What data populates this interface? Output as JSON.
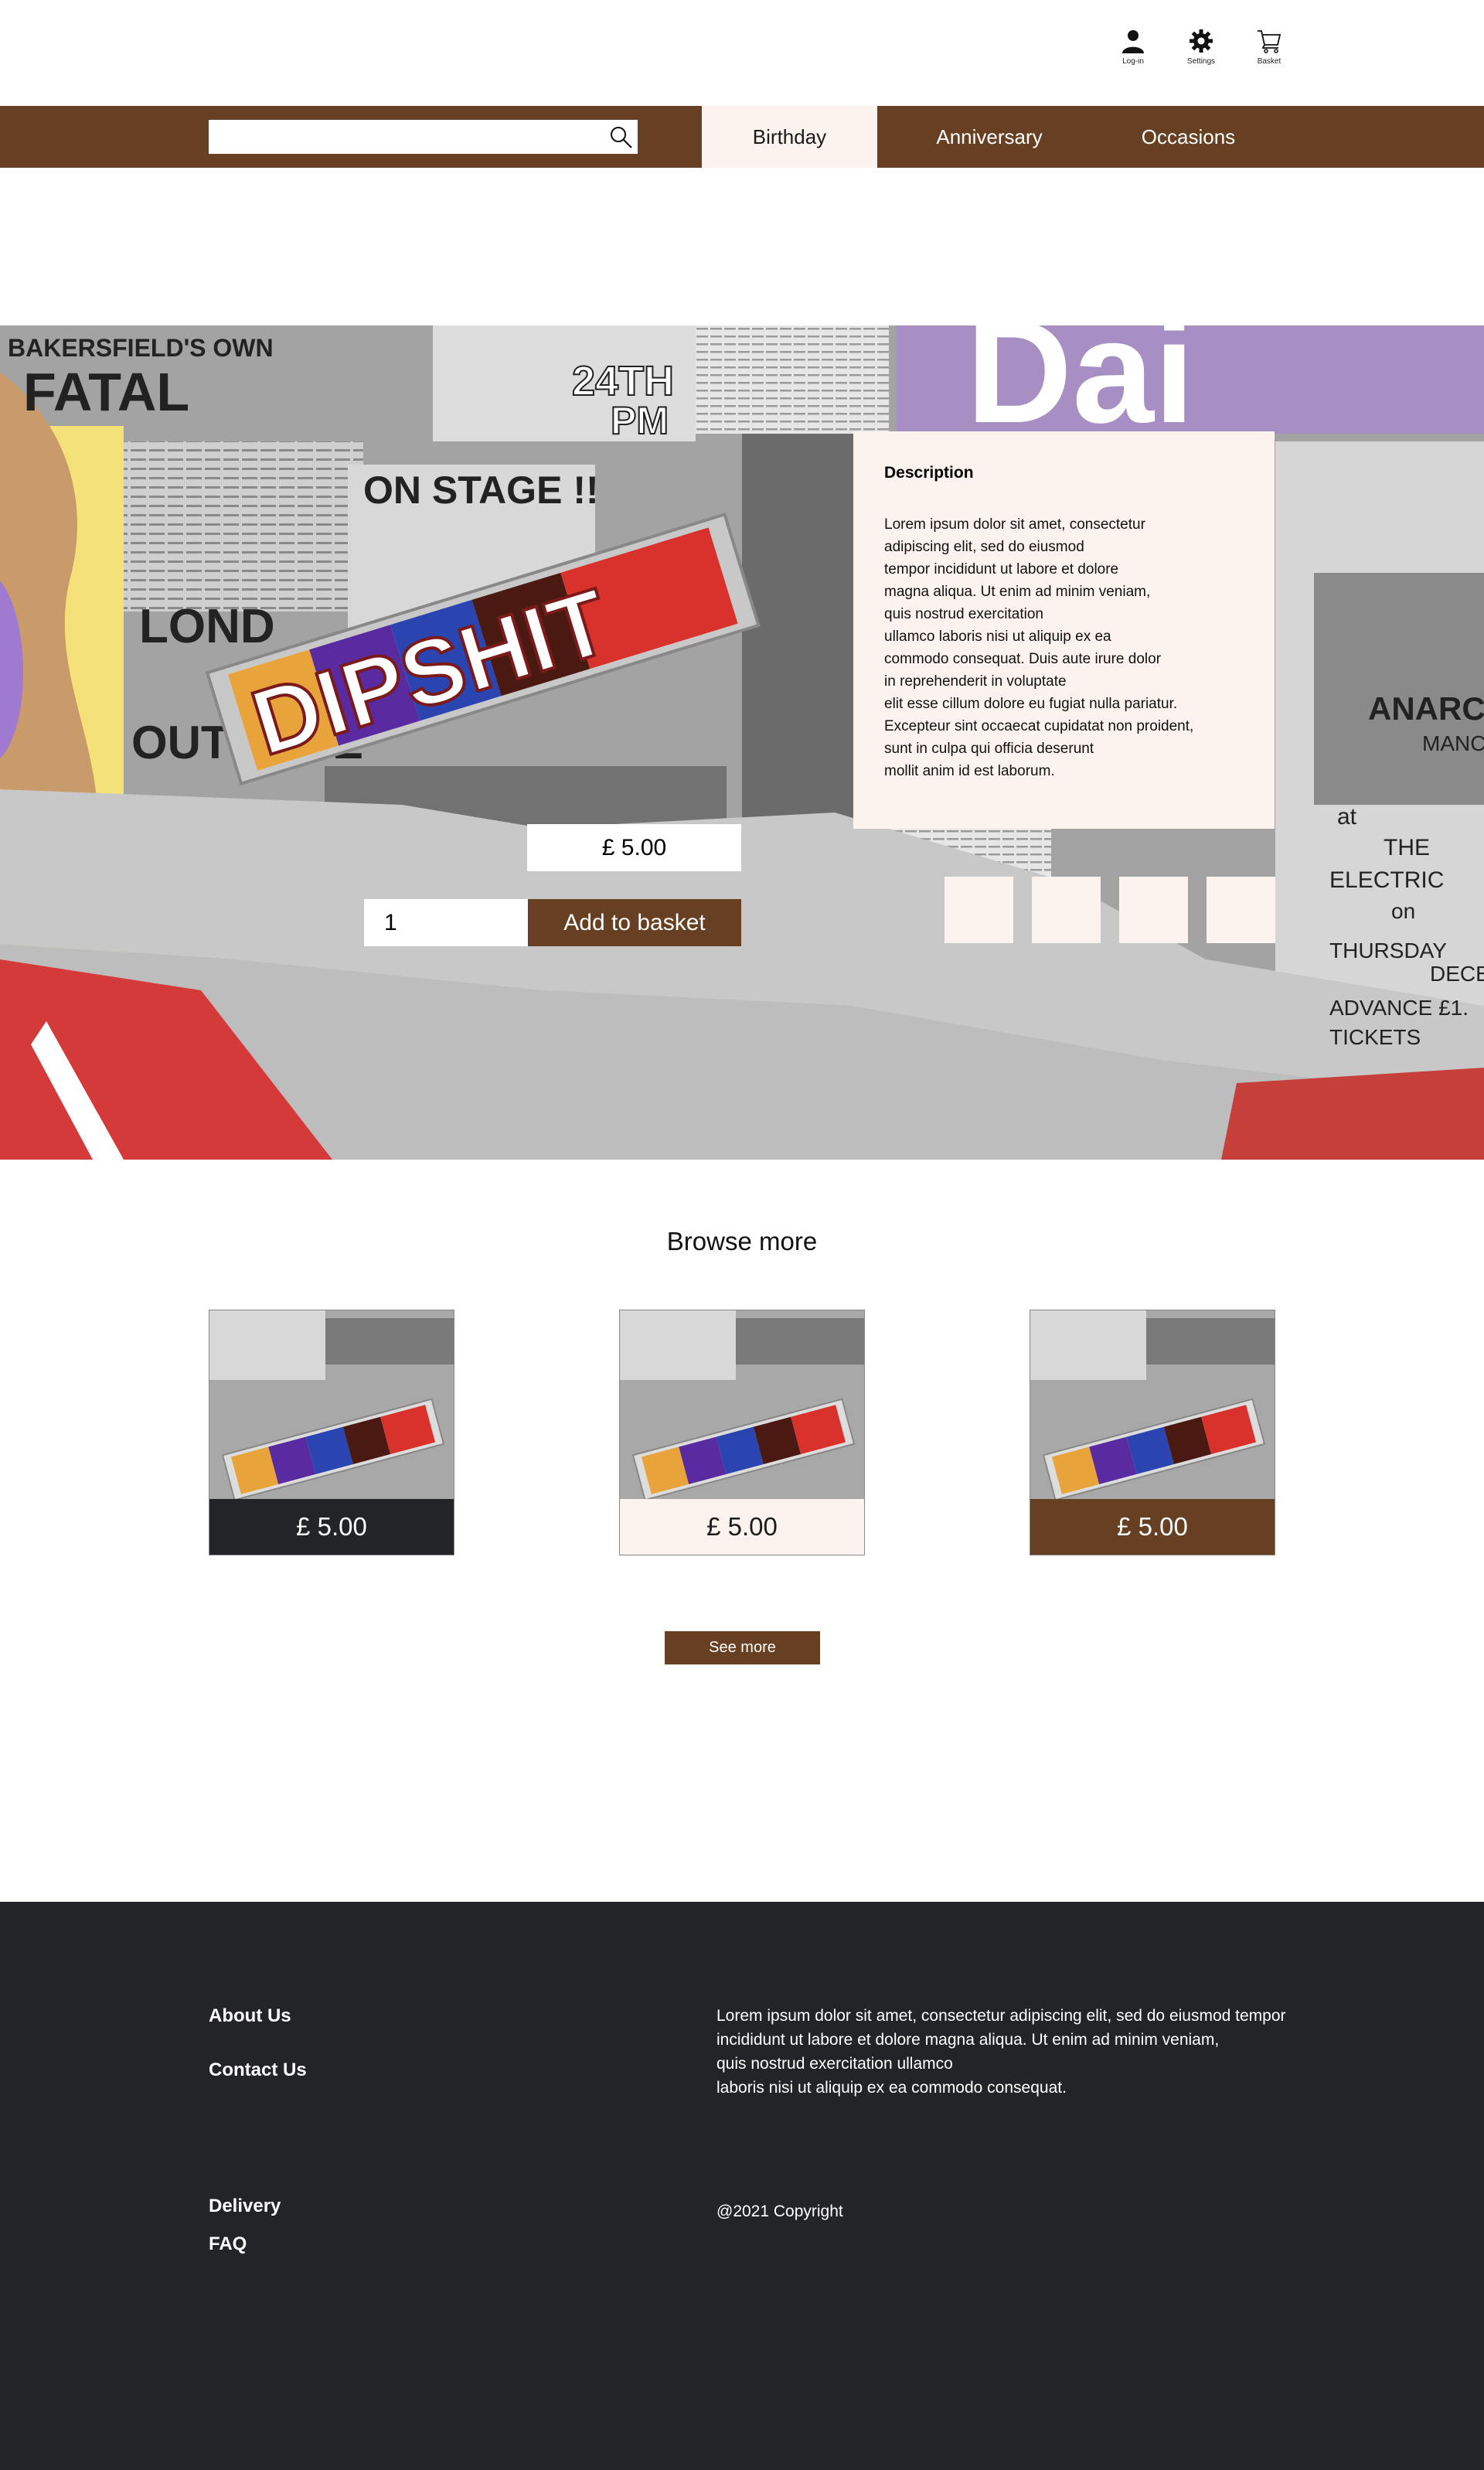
{
  "header": {
    "icons": [
      {
        "name": "user-icon",
        "label": "Log-in"
      },
      {
        "name": "gear-icon",
        "label": "Settings"
      },
      {
        "name": "cart-icon",
        "label": "Basket"
      }
    ]
  },
  "nav": {
    "search": {
      "value": "",
      "placeholder": ""
    },
    "tabs": [
      {
        "label": "Birthday",
        "active": true
      },
      {
        "label": "Anniversary",
        "active": false
      },
      {
        "label": "Occasions",
        "active": false
      }
    ]
  },
  "product": {
    "brand_text": "DIPSHIT",
    "description_title": "Description",
    "description_text": "Lorem ipsum dolor sit amet, consectetur\nadipiscing elit, sed do eiusmod\ntempor incididunt ut labore et dolore\nmagna aliqua. Ut enim ad minim veniam,\nquis nostrud exercitation\nullamco laboris nisi ut aliquip ex ea\ncommodo consequat. Duis aute irure dolor\nin reprehenderit in voluptate\nelit esse cillum dolore eu fugiat nulla pariatur.\nExcepteur sint occaecat cupidatat non proident,\nsunt in culpa qui officia deserunt\nmollit anim id est laborum.",
    "price": "£ 5.00",
    "quantity": "1",
    "add_to_basket": "Add to basket"
  },
  "collage_text": {
    "t1": "BAKERSFIELD'S OWN",
    "t2": "FATAL",
    "t3": "24TH",
    "t4": "PM",
    "t5": "ON STAGE !!",
    "t6": "LOND",
    "t7": "OUTRAGE",
    "t8": "ANARC",
    "t9": "MANC",
    "t10": "at",
    "t11": "THE",
    "t12": "ELECTRIC",
    "t13": "on",
    "t14": "THURSDAY",
    "t15": "DECE",
    "t16": "ADVANCE £1.",
    "t17": "TICKETS"
  },
  "browse": {
    "title": "Browse more",
    "cards": [
      {
        "price": "£ 5.00",
        "bg": "#232428",
        "color": "#ffffff"
      },
      {
        "price": "£ 5.00",
        "bg": "#fdf3ee",
        "color": "#1b1b1b"
      },
      {
        "price": "£ 5.00",
        "bg": "#673f22",
        "color": "#ffffff"
      }
    ],
    "see_more": "See more"
  },
  "footer": {
    "links": [
      "About Us",
      "Contact Us",
      "Delivery",
      "FAQ"
    ],
    "text": "Lorem ipsum dolor sit amet, consectetur adipiscing elit, sed do eiusmod tempor\nincididunt ut labore et dolore magna aliqua. Ut enim ad minim veniam,\nquis nostrud exercitation ullamco\nlaboris nisi ut aliquip ex ea commodo consequat.",
    "copyright": "@2021 Copyright"
  },
  "colors": {
    "brand_brown": "#673f22",
    "cream": "#fdf3ee",
    "footer_dark": "#232428"
  }
}
